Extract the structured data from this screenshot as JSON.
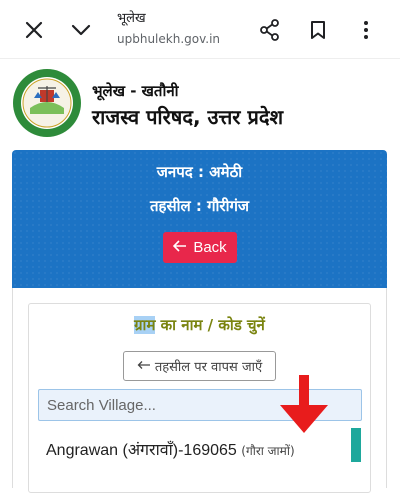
{
  "browser": {
    "tab_title": "भूलेख",
    "url": "upbhulekh.gov.in"
  },
  "header": {
    "subtitle": "भूलेख - खतौनी",
    "title": "राजस्व परिषद, उत्तर प्रदेश"
  },
  "info": {
    "janpad": "जनपद : अमेठी",
    "tehsil": "तहसील : गौरीगंज",
    "back_label": "Back"
  },
  "village": {
    "title_highlight": "ग्राम",
    "title_rest": " का नाम / कोड चुनें",
    "back_tehsil_label": "तहसील पर वापस जाएँ",
    "search_placeholder": "Search Village...",
    "items": [
      {
        "name": "Angrawan (अंगरावाँ)-169065",
        "sub": "(गौरा जामों)"
      }
    ]
  },
  "colors": {
    "card_blue": "#1c73c4",
    "back_red": "#e8274b",
    "title_olive": "#7a8410",
    "arrow_red": "#e81c1c"
  }
}
